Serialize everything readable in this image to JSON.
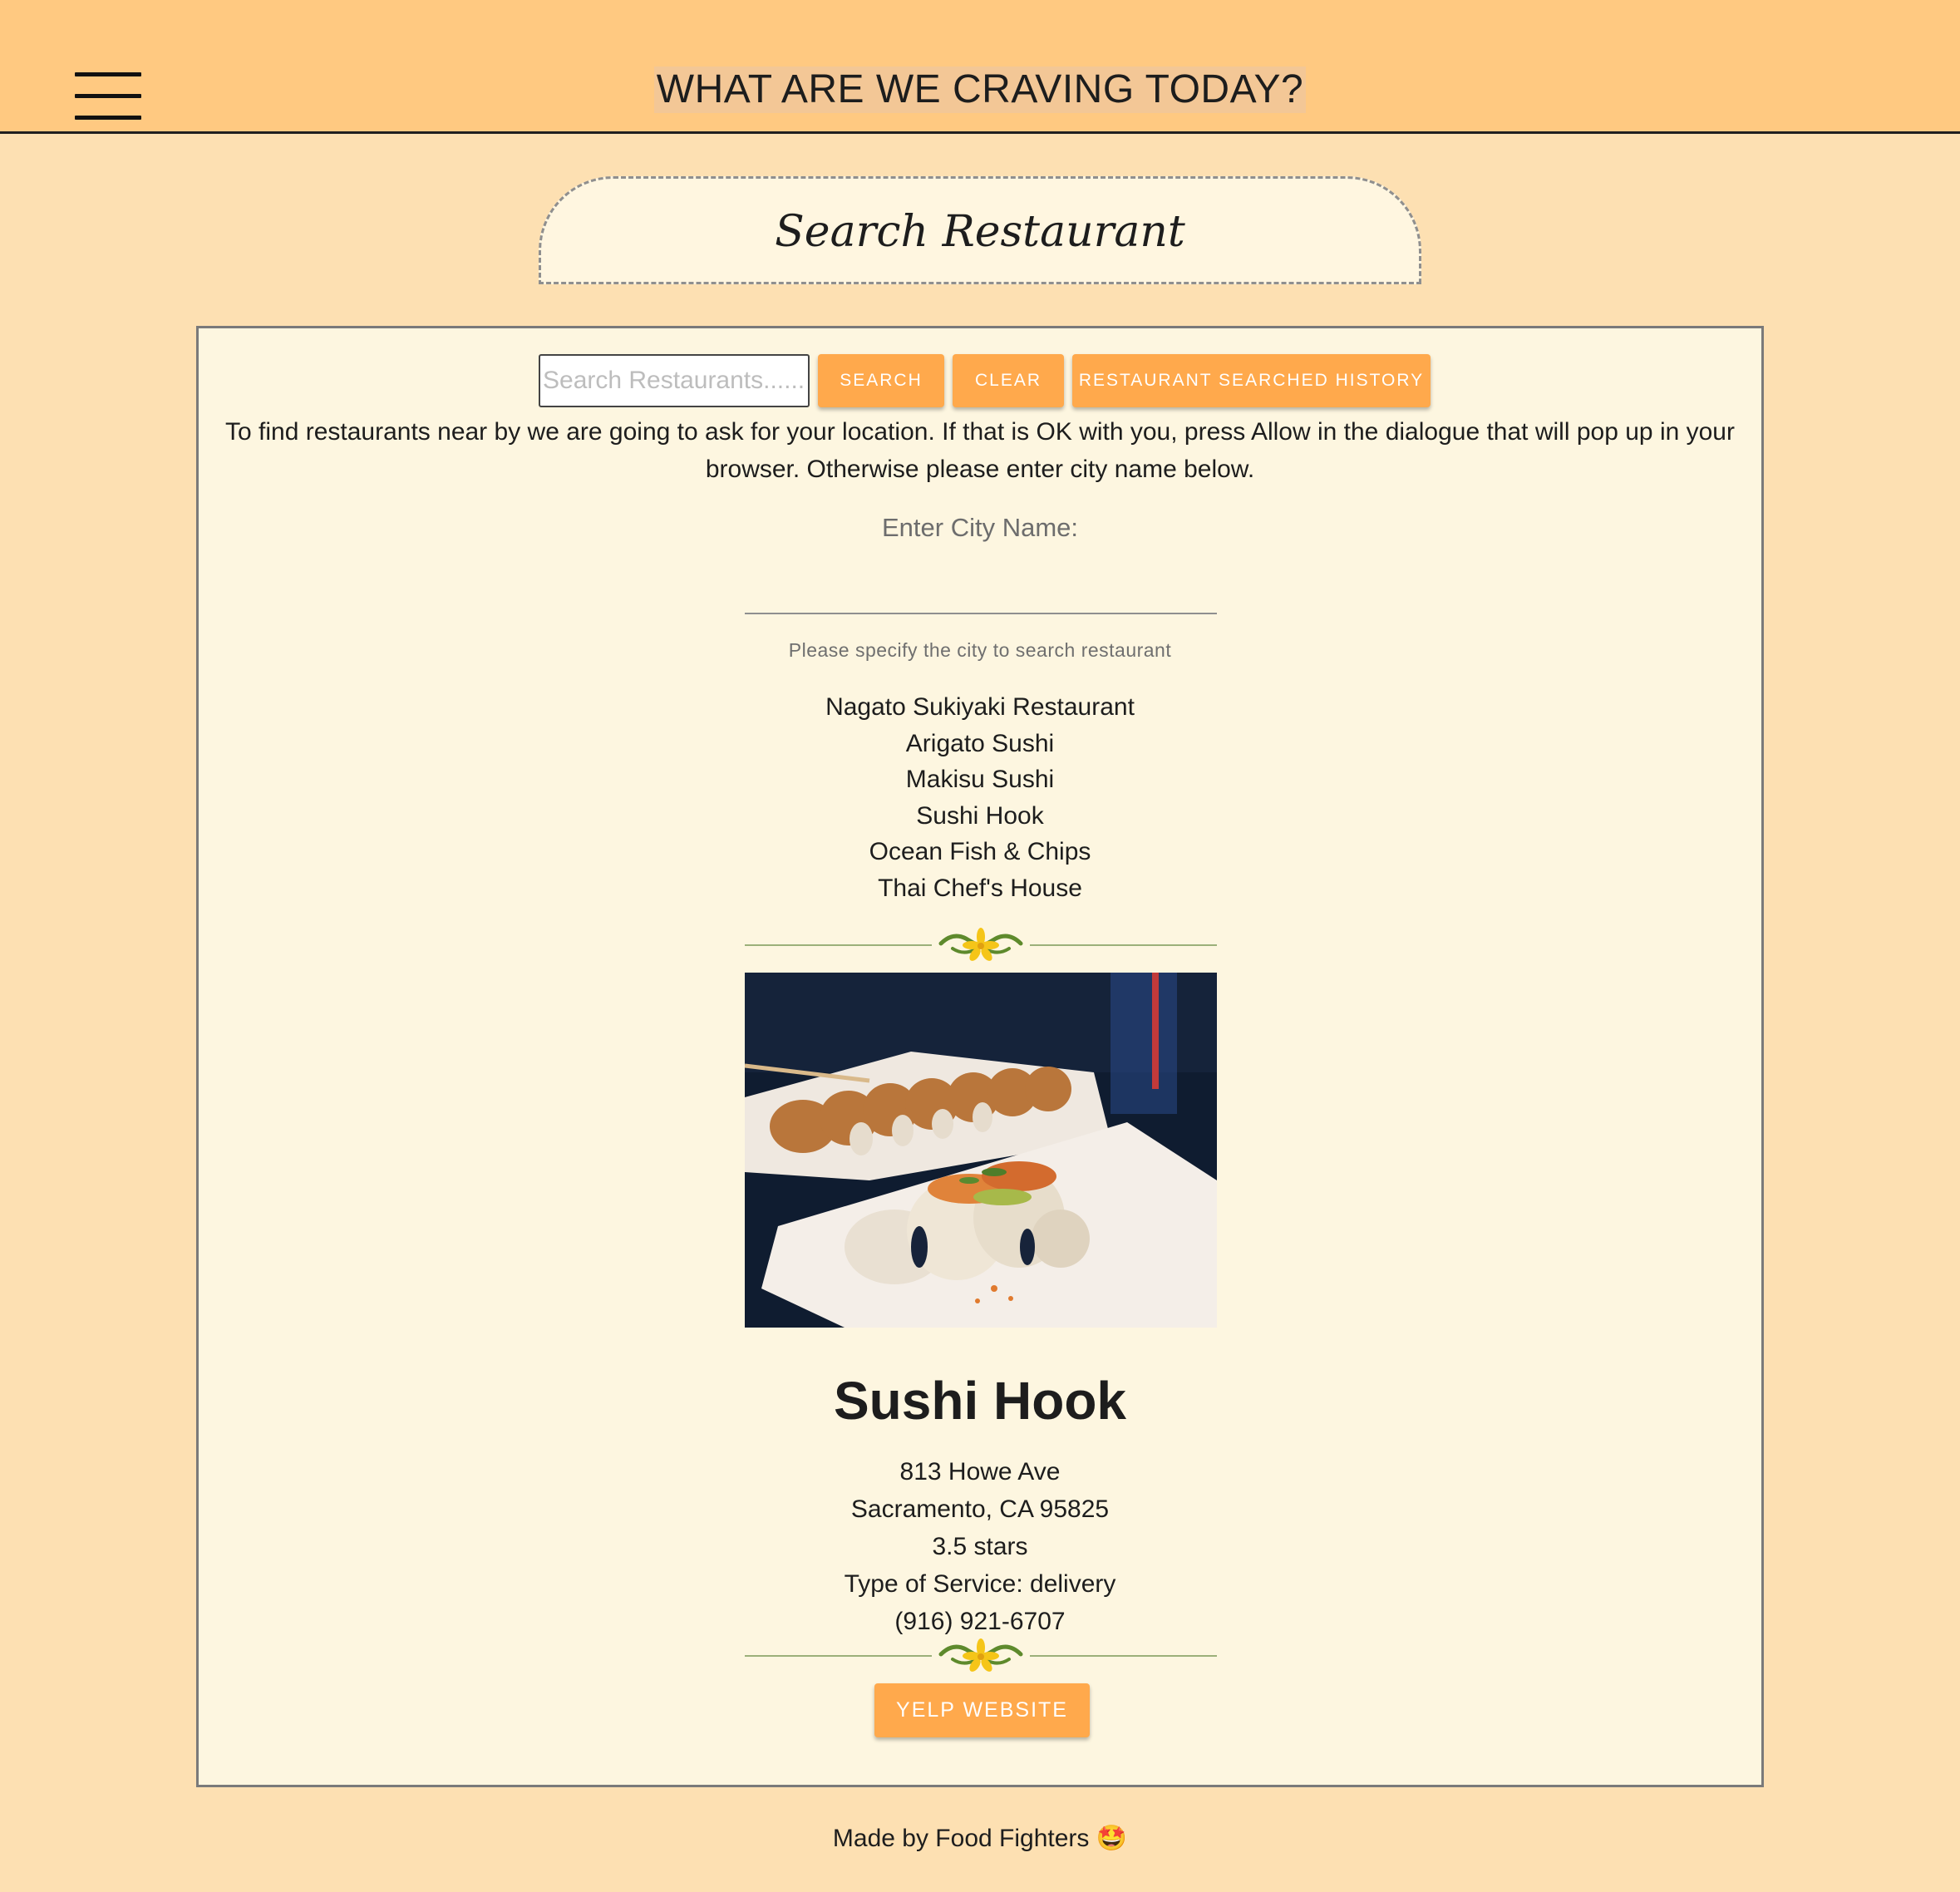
{
  "header": {
    "title": "WHAT ARE WE CRAVING TODAY?",
    "menu_icon": "hamburger-menu-icon"
  },
  "search_tab": {
    "title": "Search Restaurant"
  },
  "search": {
    "placeholder": "Search Restaurants.......",
    "search_label": "SEARCH",
    "clear_label": "CLEAR",
    "history_label": "RESTAURANT SEARCHED HISTORY"
  },
  "location_notice": "To find restaurants near by we are going to ask for your location. If that is OK with you, press Allow in the dialogue that will pop up in your browser. Otherwise please enter city name below.",
  "city": {
    "label": "Enter City Name:",
    "value": "",
    "helper": "Please specify the city to search restaurant"
  },
  "results": [
    "Nagato Sukiyaki Restaurant",
    "Arigato Sushi",
    "Makisu Sushi",
    "Sushi Hook",
    "Ocean Fish & Chips",
    "Thai Chef's House"
  ],
  "selected_restaurant": {
    "name": "Sushi Hook",
    "address_line1": "813 Howe Ave",
    "address_line2": "Sacramento, CA 95825",
    "rating": "3.5 stars",
    "service": "Type of Service: delivery",
    "phone": "(916) 921-6707",
    "yelp_label": "YELP WEBSITE"
  },
  "footer": {
    "text": "Made by Food Fighters 🤩"
  },
  "colors": {
    "topbar": "#ffc981",
    "page_background": "#fde0b2",
    "panel_background": "#fdf6e0",
    "button": "#ffa94c",
    "divider_leaf": "#5e8a2c",
    "divider_flower": "#f5c518"
  }
}
